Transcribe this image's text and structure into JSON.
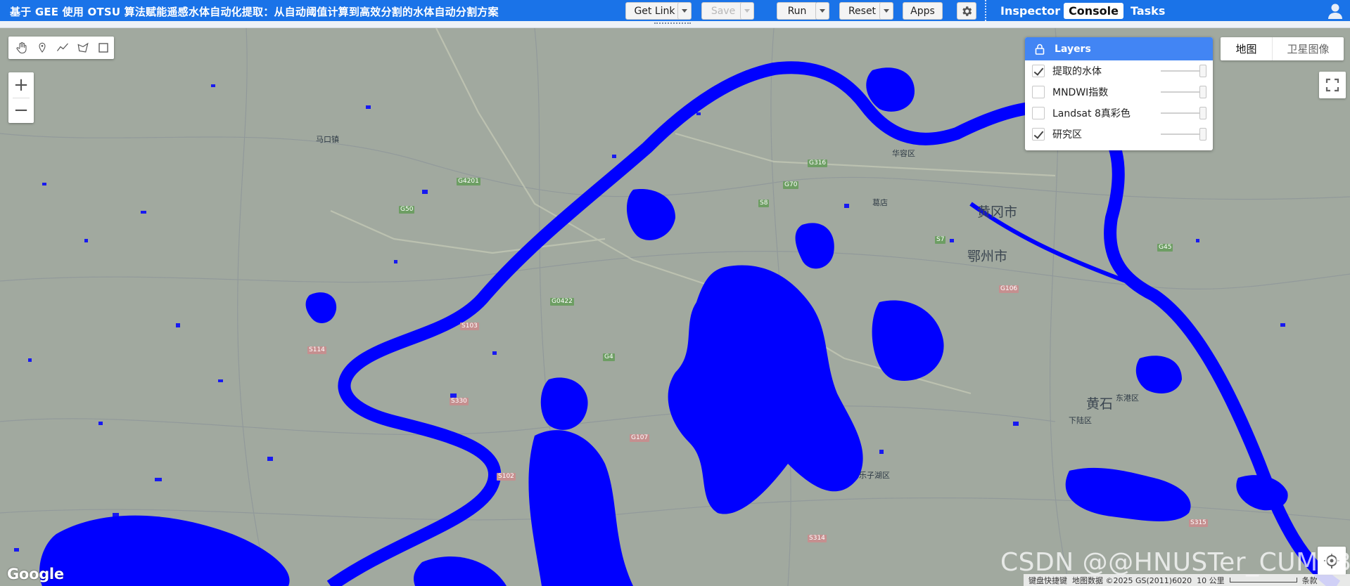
{
  "header": {
    "title": "基于 GEE 使用 OTSU 算法赋能遥感水体自动化提取：从自动阈值计算到高效分割的水体自动分割方案",
    "buttons": {
      "get_link": "Get Link",
      "save": "Save",
      "run": "Run",
      "reset": "Reset",
      "apps": "Apps"
    },
    "right_tabs": [
      "Inspector",
      "Console",
      "Tasks"
    ],
    "active_tab": "Console"
  },
  "map": {
    "layers_panel": {
      "title": "Layers",
      "layers": [
        {
          "name": "提取的水体",
          "checked": true
        },
        {
          "name": "MNDWI指数",
          "checked": false
        },
        {
          "name": "Landsat 8真彩色",
          "checked": false
        },
        {
          "name": "研究区",
          "checked": true
        }
      ]
    },
    "map_type": {
      "selected": "地图",
      "other": "卫星图像"
    },
    "zoom": {
      "in": "+",
      "out": "−"
    },
    "google_logo": "Google",
    "watermark": "CSDN @@HNUSTer_CUMTBer",
    "attribution": {
      "shortcuts": "键盘快捷键",
      "data": "地图数据 ©2025 GS(2011)6020",
      "scale": "10 公里",
      "terms": "条款"
    },
    "place_labels": [
      "黄冈市",
      "鄂州市",
      "华容区",
      "葛店",
      "下陆区",
      "黄石",
      "马口镇",
      "乐子湖区",
      "东港区"
    ],
    "road_labels": [
      "G107",
      "G316",
      "G70",
      "S8",
      "G50",
      "G4201",
      "G0422",
      "G4",
      "S7",
      "G106",
      "G45",
      "S315",
      "S314",
      "S103",
      "S114",
      "S102",
      "S330"
    ],
    "colors": {
      "water": "#0000ff",
      "basemap": "#a1a99f",
      "accent": "#1a73e8"
    }
  }
}
